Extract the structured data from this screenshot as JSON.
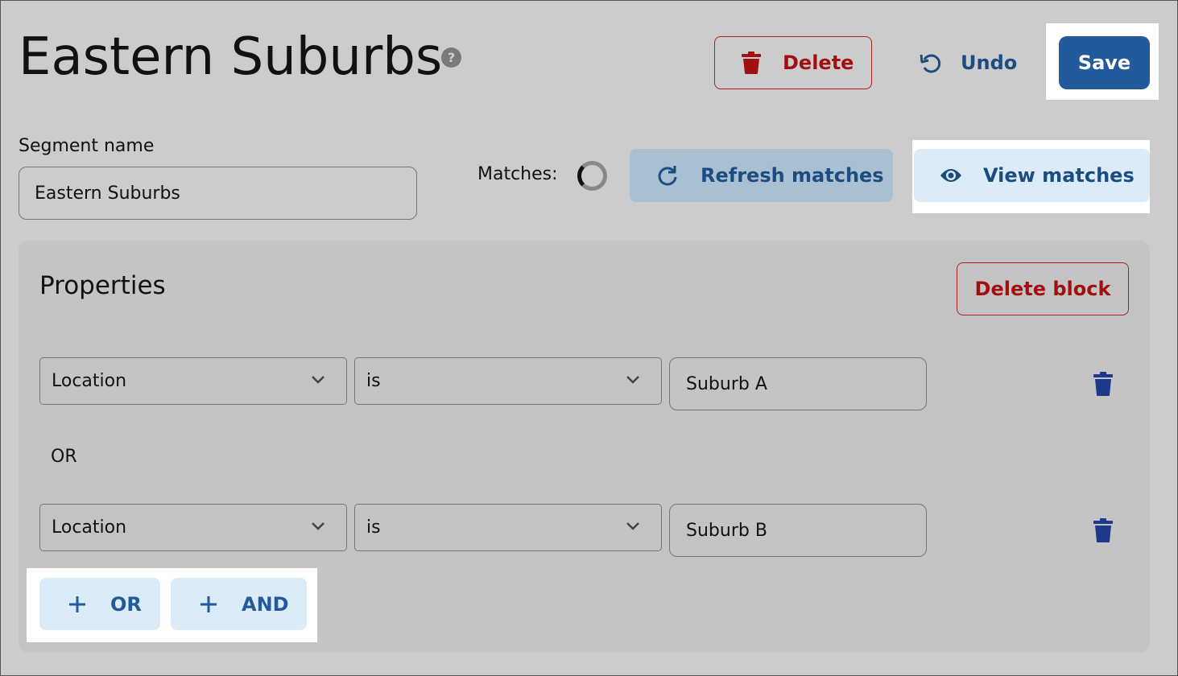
{
  "header": {
    "title": "Eastern Suburbs",
    "help_icon": "?",
    "delete_label": "Delete",
    "undo_label": "Undo",
    "save_label": "Save"
  },
  "segment": {
    "name_label": "Segment name",
    "name_value": "Eastern Suburbs",
    "matches_label": "Matches:",
    "refresh_label": "Refresh matches",
    "view_label": "View matches"
  },
  "block": {
    "title": "Properties",
    "delete_block_label": "Delete block",
    "conditions": [
      {
        "property": "Location",
        "operator": "is",
        "value": "Suburb A"
      },
      {
        "property": "Location",
        "operator": "is",
        "value": "Suburb B"
      }
    ],
    "joiner": "OR",
    "add_or_label": "OR",
    "add_and_label": "AND"
  },
  "icons": {
    "delete": "trash-icon",
    "undo": "undo-icon",
    "refresh": "refresh-icon",
    "view": "eye-icon",
    "add": "plus-icon",
    "dropdown": "chevron-down-icon",
    "loading": "spinner-icon"
  },
  "colors": {
    "primary": "#225a9c",
    "danger": "#a01010",
    "light_blue": "#dbecf8",
    "background": "#cccccc"
  }
}
